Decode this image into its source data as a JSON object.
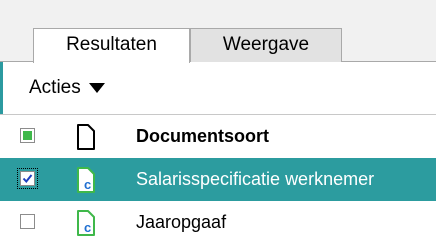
{
  "tabs": [
    {
      "label": "Resultaten",
      "active": true
    },
    {
      "label": "Weergave",
      "active": false
    }
  ],
  "toolbar": {
    "actions_label": "Acties"
  },
  "table": {
    "header": {
      "select_all_state": "partial",
      "column_label": "Documentsoort"
    },
    "rows": [
      {
        "label": "Salarisspecificatie werknemer",
        "checked": true,
        "selected": true,
        "icon": "document-c-icon"
      },
      {
        "label": "Jaaropgaaf",
        "checked": false,
        "selected": false,
        "icon": "document-c-icon"
      }
    ]
  },
  "colors": {
    "accent": "#2c9c9f",
    "checkbox_fill": "#3fb84a",
    "icon_green": "#3fb84a",
    "icon_blue": "#1f6fd1"
  }
}
